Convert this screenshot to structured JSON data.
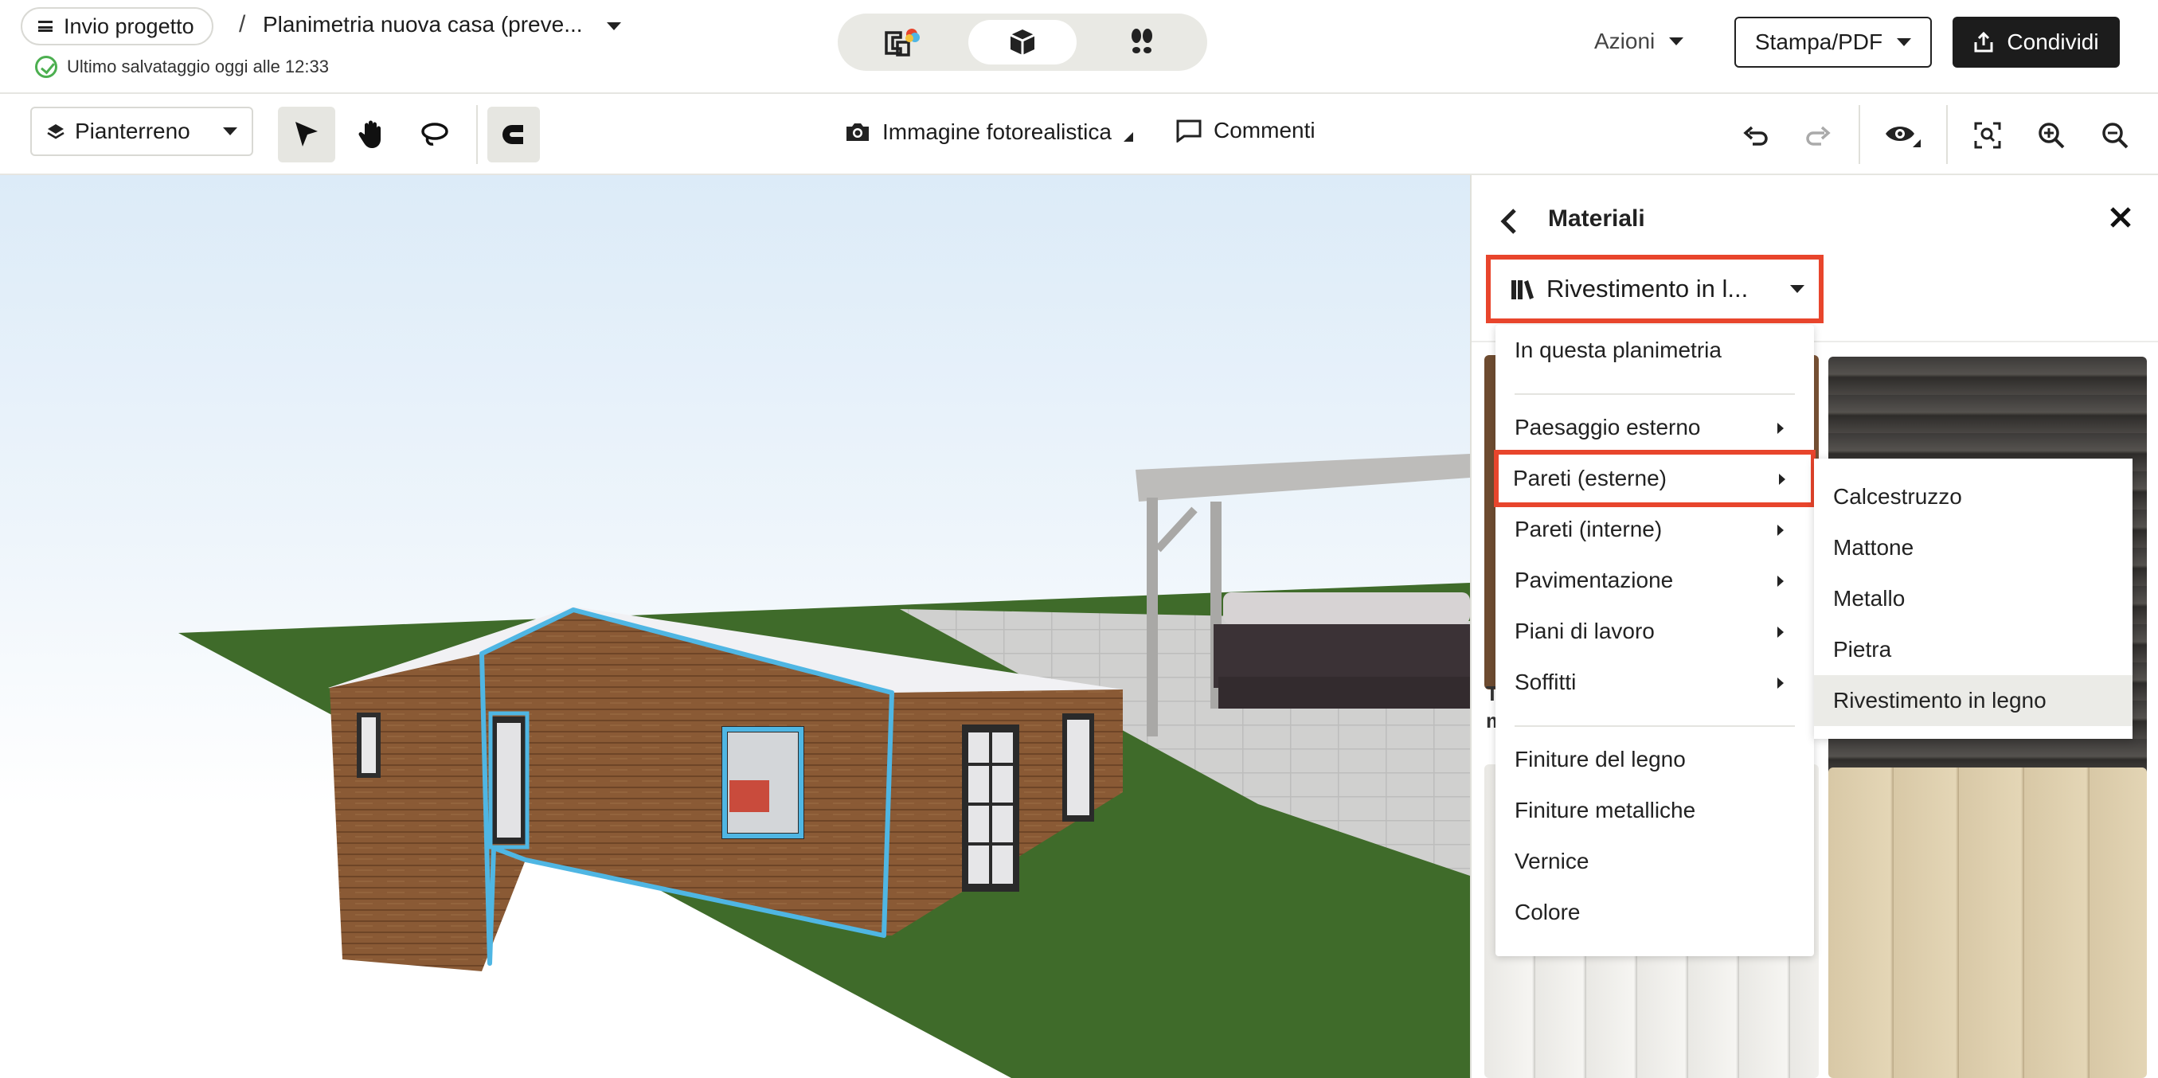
{
  "header": {
    "project_button": "Invio progetto",
    "breadcrumb_separator": "/",
    "plan_title": "Planimetria nuova casa (preve...",
    "save_status": "Ultimo salvataggio oggi alle 12:33",
    "view_modes": [
      "2d-plan-icon",
      "3d-box-icon",
      "walk-footsteps-icon"
    ],
    "azioni_label": "Azioni",
    "print_label": "Stampa/PDF",
    "share_label": "Condividi"
  },
  "toolbar": {
    "floor_label": "Pianterreno",
    "photo_label": "Immagine fotorealistica",
    "comments_label": "Commenti"
  },
  "panel": {
    "title": "Materiali",
    "category_selected": "Rivestimento in l...",
    "tile_caption_1": "T",
    "tile_caption_2": "m"
  },
  "menu": {
    "items": [
      {
        "label": "In questa planimetria"
      },
      {
        "label": "Paesaggio esterno"
      },
      {
        "label": "Pareti (esterne)"
      },
      {
        "label": "Pareti (interne)"
      },
      {
        "label": "Pavimentazione"
      },
      {
        "label": "Piani di lavoro"
      },
      {
        "label": "Soffitti"
      },
      {
        "label": "Finiture del legno"
      },
      {
        "label": "Finiture metalliche"
      },
      {
        "label": "Vernice"
      },
      {
        "label": "Colore"
      }
    ]
  },
  "submenu": {
    "items": [
      {
        "label": "Calcestruzzo"
      },
      {
        "label": "Mattone"
      },
      {
        "label": "Metallo"
      },
      {
        "label": "Pietra"
      },
      {
        "label": "Rivestimento in legno"
      }
    ],
    "selected": "Rivestimento in legno"
  },
  "colors": {
    "highlight": "#e8452c",
    "selection_outline": "#4fb6e3",
    "grass": "#3f6b2a",
    "wood": "#8a5a35"
  }
}
